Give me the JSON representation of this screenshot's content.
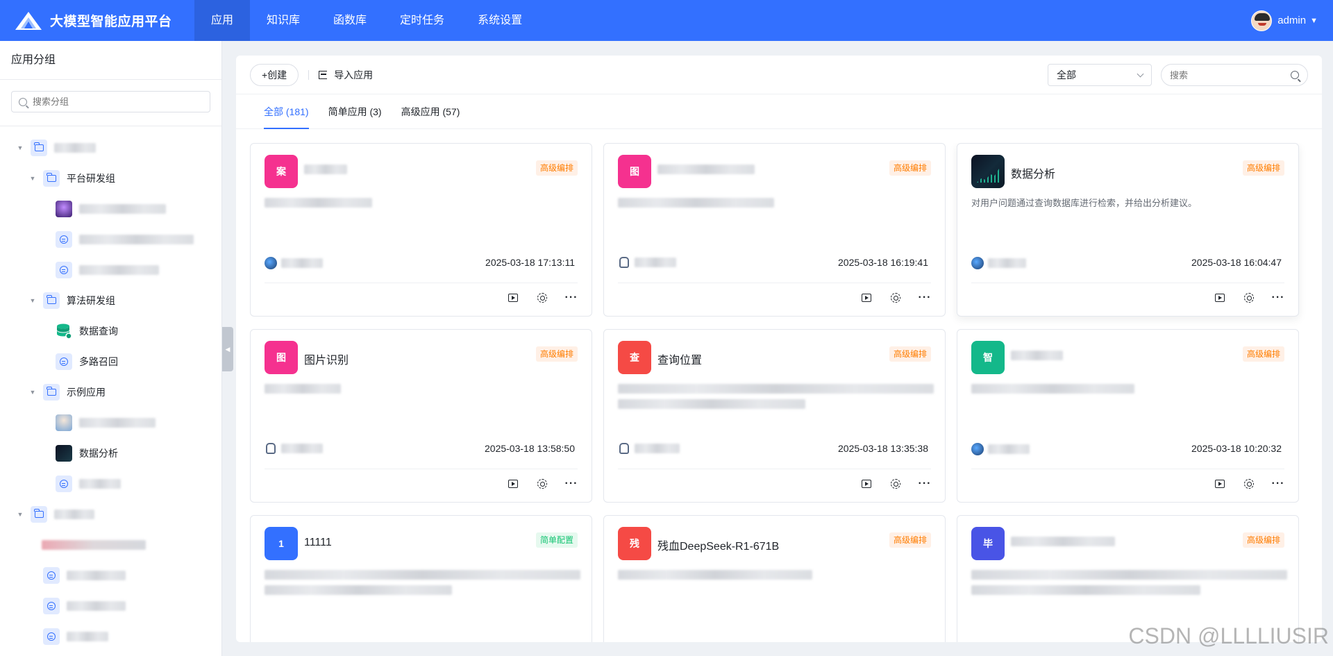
{
  "header": {
    "brand": "大模型智能应用平台",
    "nav": [
      {
        "label": "应用",
        "active": true
      },
      {
        "label": "知识库",
        "active": false
      },
      {
        "label": "函数库",
        "active": false
      },
      {
        "label": "定时任务",
        "active": false
      },
      {
        "label": "系统设置",
        "active": false
      }
    ],
    "user": "admin"
  },
  "sidebar": {
    "title": "应用分组",
    "search_placeholder": "搜索分组",
    "tree": {
      "sub1": "平台研发组",
      "sub2": "算法研发组",
      "sub2_items": [
        "数据查询",
        "多路召回"
      ],
      "sub3": "示例应用",
      "sub3_item": "数据分析"
    }
  },
  "toolbar": {
    "create": "+创建",
    "import": "导入应用",
    "filter_value": "全部",
    "search_placeholder": "搜索"
  },
  "tabs": [
    "全部 (181)",
    "简单应用 (3)",
    "高级应用 (57)"
  ],
  "cards": [
    {
      "icon_char": "案",
      "icon_color": "#f5318f",
      "name": "",
      "tag": "高级编排",
      "tag_type": "adv",
      "desc": "",
      "time": "2025-03-18 17:13:11"
    },
    {
      "icon_char": "图",
      "icon_color": "#f5318f",
      "name": "",
      "tag": "高级编排",
      "tag_type": "adv",
      "desc": "",
      "time": "2025-03-18 16:19:41"
    },
    {
      "icon_char": "",
      "icon_color": "#0c1222",
      "name": "数据分析",
      "tag": "高级编排",
      "tag_type": "adv",
      "desc": "对用户问题通过查询数据库进行检索，并给出分析建议。",
      "time": "2025-03-18 16:04:47"
    },
    {
      "icon_char": "图",
      "icon_color": "#f5318f",
      "name": "图片识别",
      "tag": "高级编排",
      "tag_type": "adv",
      "desc": "",
      "time": "2025-03-18 13:58:50"
    },
    {
      "icon_char": "查",
      "icon_color": "#f54a45",
      "name": "查询位置",
      "tag": "高级编排",
      "tag_type": "adv",
      "desc": "",
      "time": "2025-03-18 13:35:38"
    },
    {
      "icon_char": "智",
      "icon_color": "#14b88a",
      "name": "",
      "tag": "高级编排",
      "tag_type": "adv",
      "desc": "",
      "time": "2025-03-18 10:20:32"
    },
    {
      "icon_char": "1",
      "icon_color": "#3370ff",
      "name": "11111",
      "tag": "简单配置",
      "tag_type": "simple",
      "desc": "",
      "time": ""
    },
    {
      "icon_char": "残",
      "icon_color": "#f54a45",
      "name": "残血DeepSeek-R1-671B",
      "tag": "高级编排",
      "tag_type": "adv",
      "desc": "",
      "time": ""
    },
    {
      "icon_char": "毕",
      "icon_color": "#4954e6",
      "name": "",
      "tag": "高级编排",
      "tag_type": "adv",
      "desc": "",
      "time": ""
    }
  ],
  "watermark": "CSDN @LLLLIUSIR"
}
